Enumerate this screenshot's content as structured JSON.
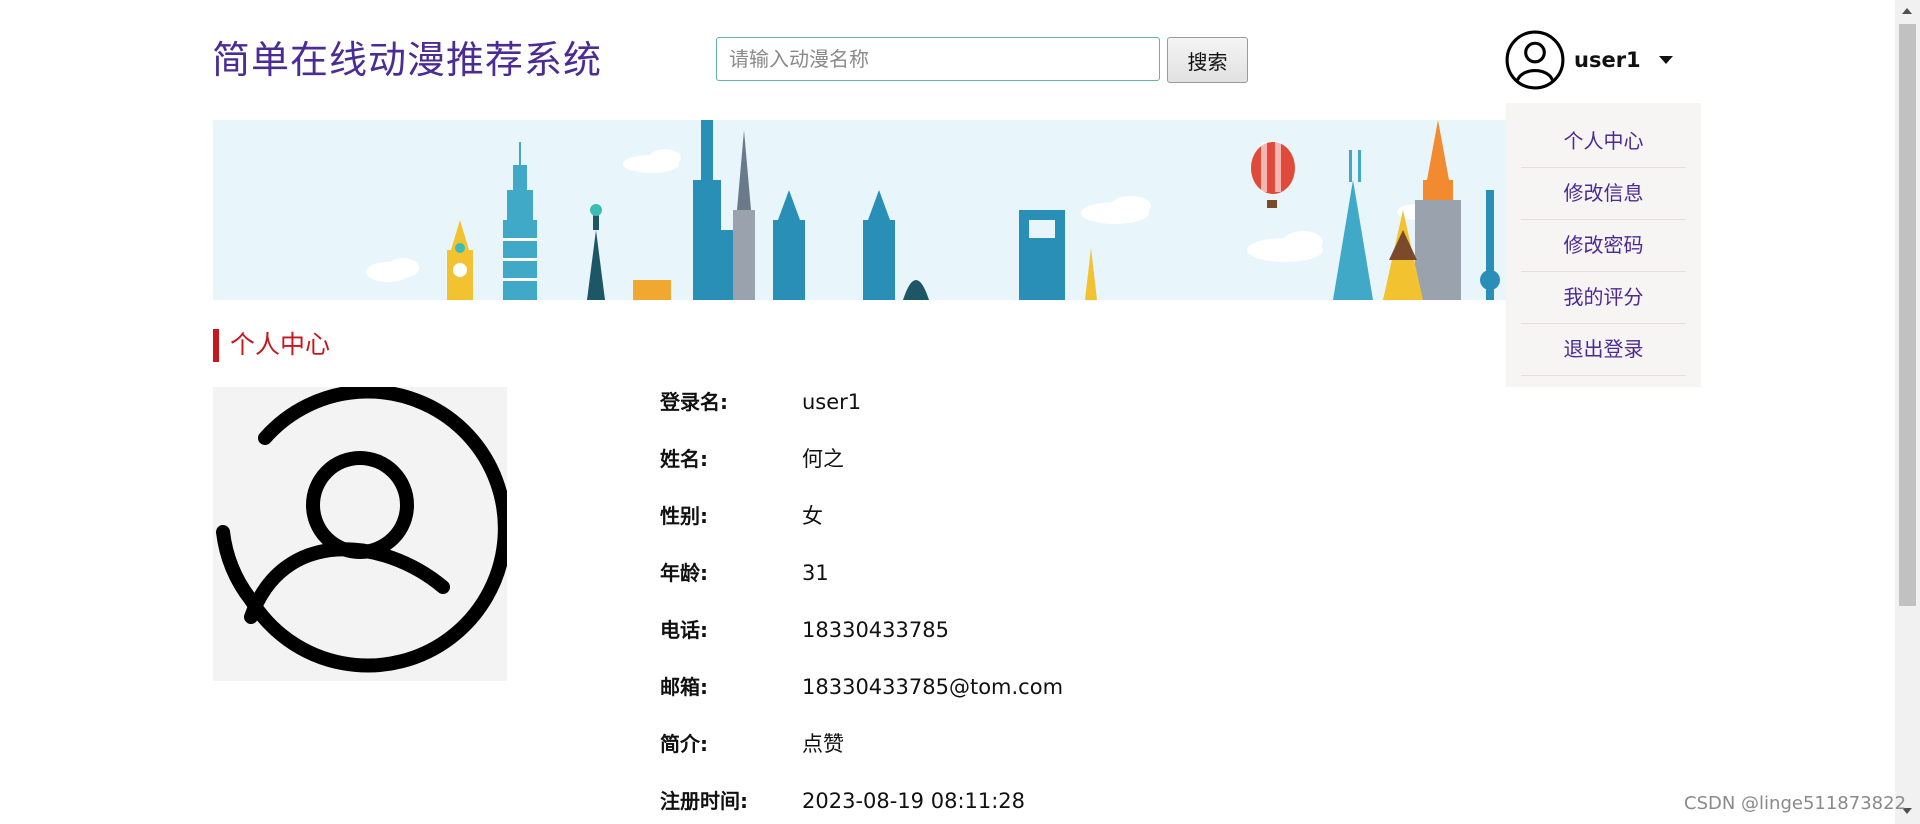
{
  "header": {
    "site_title": "简单在线动漫推荐系统",
    "search_placeholder": "请输入动漫名称",
    "search_button": "搜索",
    "username": "user1"
  },
  "dropdown": {
    "items": [
      "个人中心",
      "修改信息",
      "修改密码",
      "我的评分",
      "退出登录"
    ]
  },
  "section": {
    "title": "个人中心"
  },
  "profile": {
    "rows": [
      {
        "label": "登录名:",
        "value": "user1"
      },
      {
        "label": "姓名:",
        "value": "何之"
      },
      {
        "label": "性别:",
        "value": "女"
      },
      {
        "label": "年龄:",
        "value": "31"
      },
      {
        "label": "电话:",
        "value": "18330433785"
      },
      {
        "label": "邮箱:",
        "value": "18330433785@tom.com"
      },
      {
        "label": "简介:",
        "value": "点赞"
      },
      {
        "label": "注册时间:",
        "value": "2023-08-19 08:11:28"
      }
    ]
  },
  "watermark": "CSDN @linge511873822",
  "colors": {
    "title": "#4b2b94",
    "section_accent": "#c8161d",
    "dropdown_bg": "#f7f4f4",
    "banner_sky": "#e8f5fb"
  },
  "icons": {
    "user_avatar": "user-circle-icon",
    "dropdown_caret": "caret-down-icon"
  }
}
